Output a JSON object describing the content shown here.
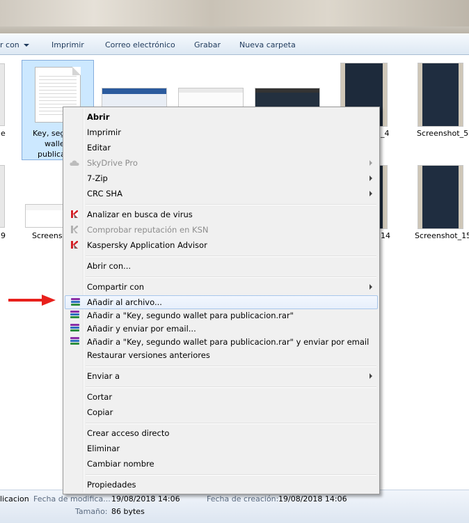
{
  "toolbar": {
    "open_with": "r con",
    "print": "Imprimir",
    "email": "Correo electrónico",
    "burn": "Grabar",
    "new_folder": "Nueva carpeta"
  },
  "files": {
    "selected_line1": "Key, seg",
    "selected_line2": "wallet",
    "selected_line3": "publica",
    "left_partial_1": "e",
    "left_partial_2": "9",
    "screenshot_partial": "Screensh",
    "r1_partial": "_4",
    "r2_partial": "14",
    "screenshot_5": "Screenshot_5",
    "screenshot_15": "Screenshot_15"
  },
  "context_menu": {
    "open": "Abrir",
    "print": "Imprimir",
    "edit": "Editar",
    "skydrive": "SkyDrive Pro",
    "seven_zip": "7-Zip",
    "crc_sha": "CRC SHA",
    "scan_virus": "Analizar en busca de virus",
    "check_reputation": "Comprobar reputación en KSN",
    "kaspersky_advisor": "Kaspersky Application Advisor",
    "open_with": "Abrir con...",
    "share_with": "Compartir con",
    "add_to_archive": "Añadir al archivo...",
    "add_to_rar": "Añadir a \"Key, segundo wallet para publicacion.rar\"",
    "add_email": "Añadir y enviar por email...",
    "add_rar_email": "Añadir a \"Key, segundo wallet para publicacion.rar\" y enviar por email",
    "restore_versions": "Restaurar versiones anteriores",
    "send_to": "Enviar a",
    "cut": "Cortar",
    "copy": "Copiar",
    "create_shortcut": "Crear acceso directo",
    "delete": "Eliminar",
    "rename": "Cambiar nombre",
    "properties": "Propiedades"
  },
  "status": {
    "name_partial": "licacion",
    "modified_label": "Fecha de modifica...",
    "modified_value": "19/08/2018 14:06",
    "created_label": "Fecha de creación:",
    "created_value": "19/08/2018 14:06",
    "size_label": "Tamaño:",
    "size_value": "86 bytes"
  },
  "colors": {
    "toolbar_text": "#1e395b",
    "selection_fill": "#cce8ff",
    "highlight_border": "#a8c7ec",
    "arrow_red": "#e8201c"
  },
  "icons": {
    "kaspersky": "kaspersky-k-icon",
    "winrar": "winrar-books-icon",
    "skydrive": "cloud-icon",
    "pointer": "red-arrow-icon"
  }
}
